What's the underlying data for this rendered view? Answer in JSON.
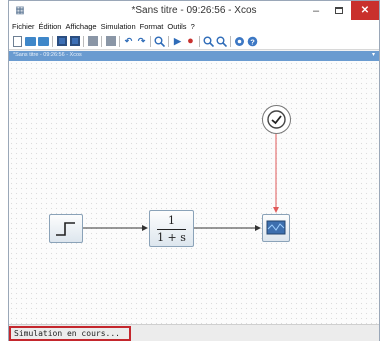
{
  "window": {
    "title": "*Sans titre - 09:26:56 - Xcos",
    "close_glyph": "✕",
    "minimize_glyph": "–"
  },
  "menubar": {
    "items": [
      "Fichier",
      "Édition",
      "Affichage",
      "Simulation",
      "Format",
      "Outils",
      "?"
    ]
  },
  "toolbar": {
    "icons": [
      "new-diagram-icon",
      "open-icon",
      "open-folder-icon",
      "save-icon",
      "save-as-icon",
      "print-icon",
      "print-preview-icon",
      "undo-icon",
      "redo-icon",
      "fit-diagram-icon",
      "start-icon",
      "stop-icon",
      "zoom-in-icon",
      "zoom-out-icon",
      "xcos-demos-icon",
      "help-icon"
    ],
    "start_glyph": "▶",
    "stop_glyph": "●",
    "undo_glyph": "↶",
    "redo_glyph": "↷"
  },
  "tab": {
    "label": "*Sans titre - 09:26:56 - Xcos",
    "menu_glyph": "▾"
  },
  "diagram": {
    "blocks": {
      "step": {
        "name": "step-block"
      },
      "transfer_function": {
        "numerator": "1",
        "denominator": "1 + s"
      },
      "scope": {
        "name": "scope-block"
      },
      "clock": {
        "name": "clock-block"
      }
    },
    "colors": {
      "regular_link": "#333333",
      "event_link": "#e05a5a",
      "block_border": "#8aa2b8"
    }
  },
  "status": {
    "text": "Simulation en cours...",
    "highlight_color": "#c4272d"
  }
}
